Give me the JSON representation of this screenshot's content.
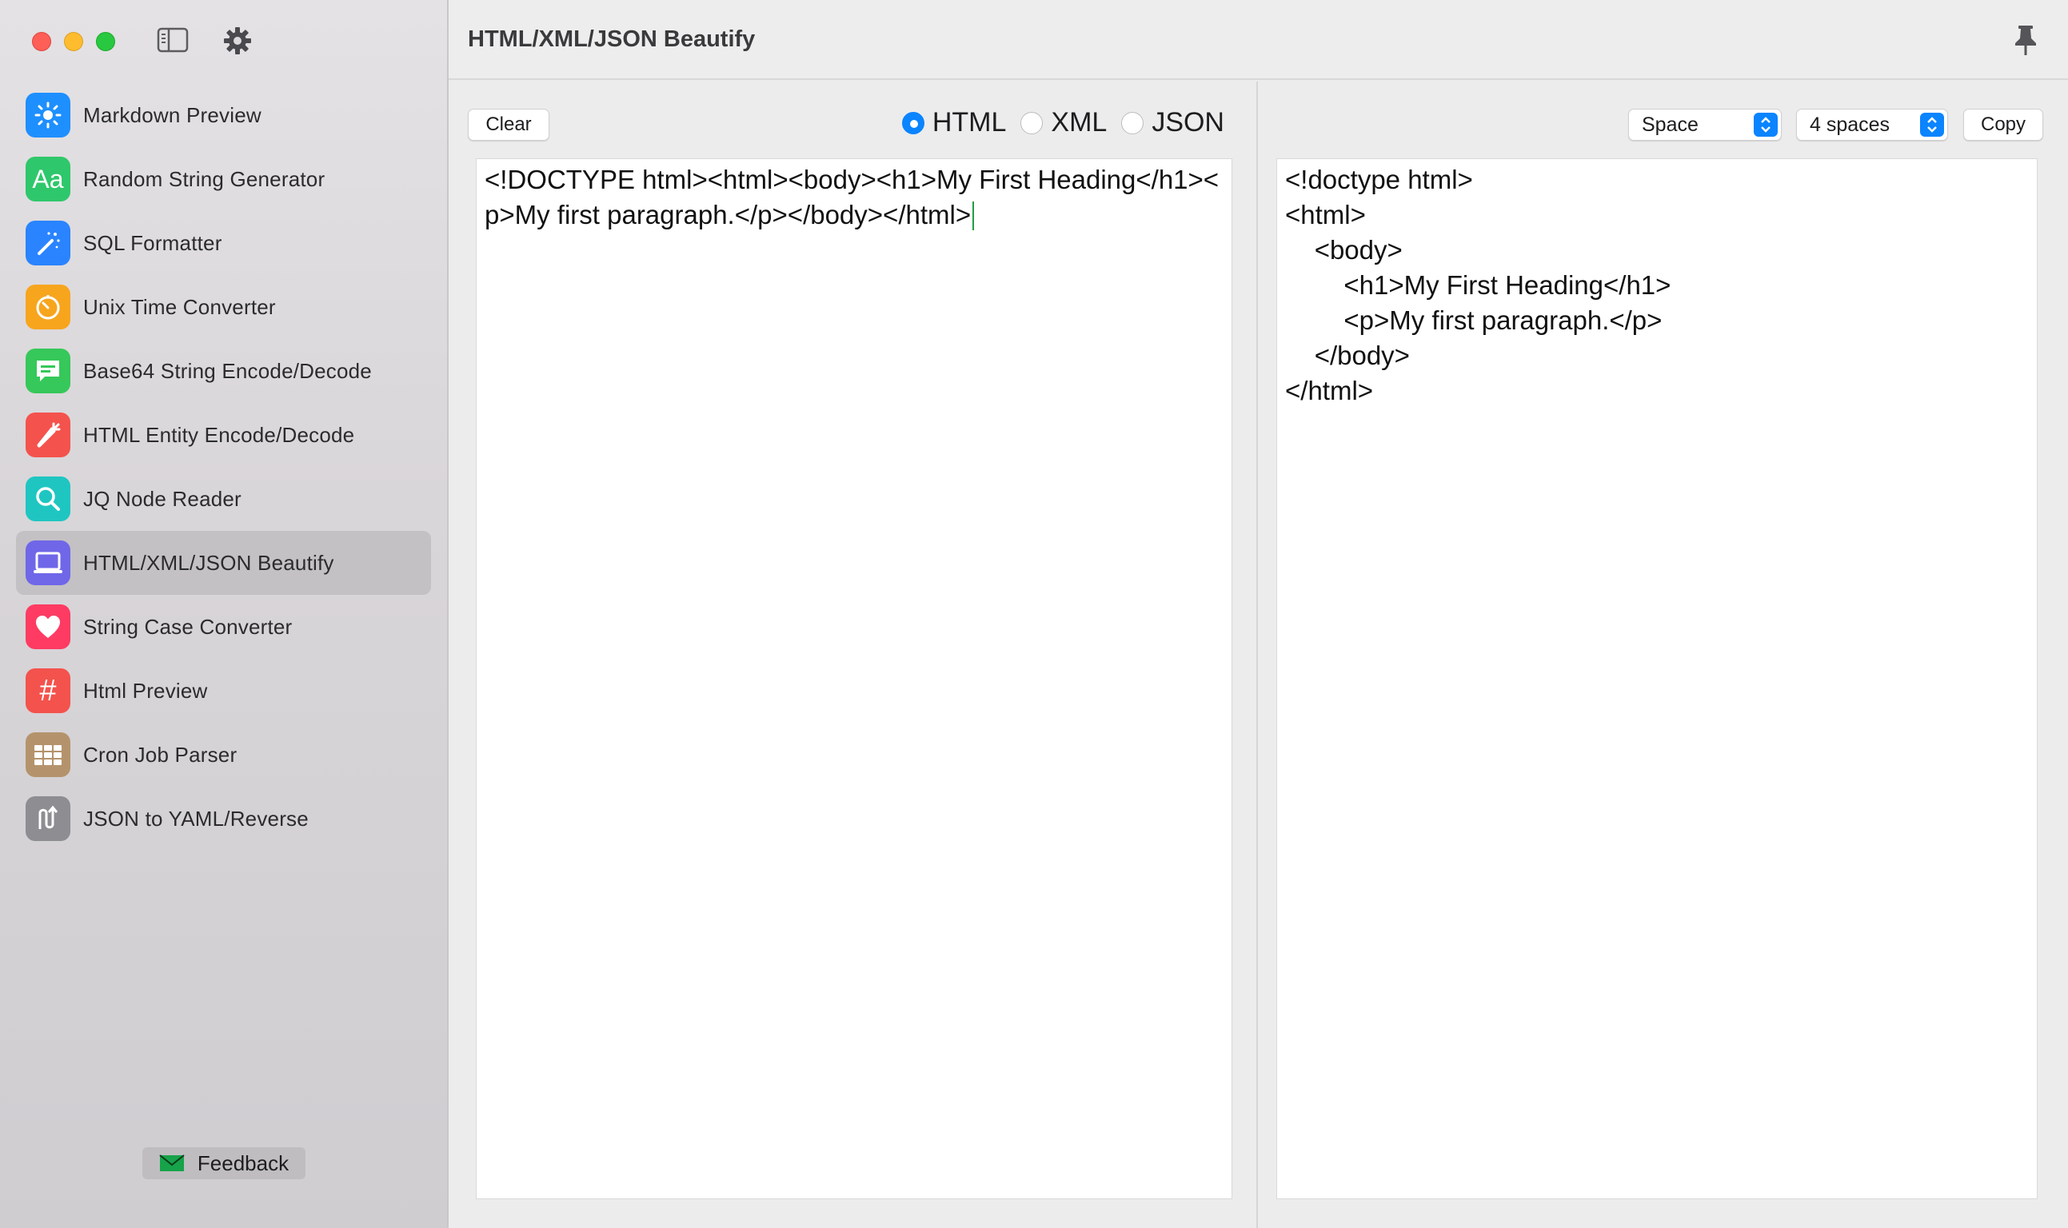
{
  "window": {
    "title": "HTML/XML/JSON Beautify"
  },
  "sidebar": {
    "items": [
      {
        "label": "Markdown Preview",
        "icon": "sun-icon",
        "color": "#1e8fff"
      },
      {
        "label": "Random String Generator",
        "icon": "text-aa-icon",
        "color": "#2fc76b"
      },
      {
        "label": "SQL Formatter",
        "icon": "magic-wand-icon",
        "color": "#2a84ff"
      },
      {
        "label": "Unix Time Converter",
        "icon": "timer-icon",
        "color": "#f7a51d"
      },
      {
        "label": "Base64 String Encode/Decode",
        "icon": "message-bubble-icon",
        "color": "#36c85a"
      },
      {
        "label": "HTML Entity Encode/Decode",
        "icon": "carrot-icon",
        "color": "#f4524d"
      },
      {
        "label": "JQ Node Reader",
        "icon": "magnifier-icon",
        "color": "#1fc6c1"
      },
      {
        "label": "HTML/XML/JSON Beautify",
        "icon": "laptop-icon",
        "color": "#6f67e8",
        "active": true
      },
      {
        "label": "String Case Converter",
        "icon": "heart-icon",
        "color": "#ff3b63"
      },
      {
        "label": "Html Preview",
        "icon": "hashtag-icon",
        "color": "#f4524d"
      },
      {
        "label": "Cron Job Parser",
        "icon": "grid-icon",
        "color": "#b4936c"
      },
      {
        "label": "JSON to YAML/Reverse",
        "icon": "swap-arrows-icon",
        "color": "#8d8d92"
      }
    ],
    "feedback_label": "Feedback"
  },
  "left_pane": {
    "clear_label": "Clear",
    "radio_options": [
      "HTML",
      "XML",
      "JSON"
    ],
    "selected_format": "HTML",
    "input_text": "<!DOCTYPE html><html><body><h1>My First Heading</h1><p>My first paragraph.</p></body></html>"
  },
  "right_pane": {
    "indent_type": "Space",
    "indent_size": "4 spaces",
    "copy_label": "Copy",
    "output_text": "<!doctype html>\n<html>\n    <body>\n        <h1>My First Heading</h1>\n        <p>My first paragraph.</p>\n    </body>\n</html>"
  },
  "colors": {
    "accent": "#0a84ff",
    "caret": "#1f9d44"
  }
}
